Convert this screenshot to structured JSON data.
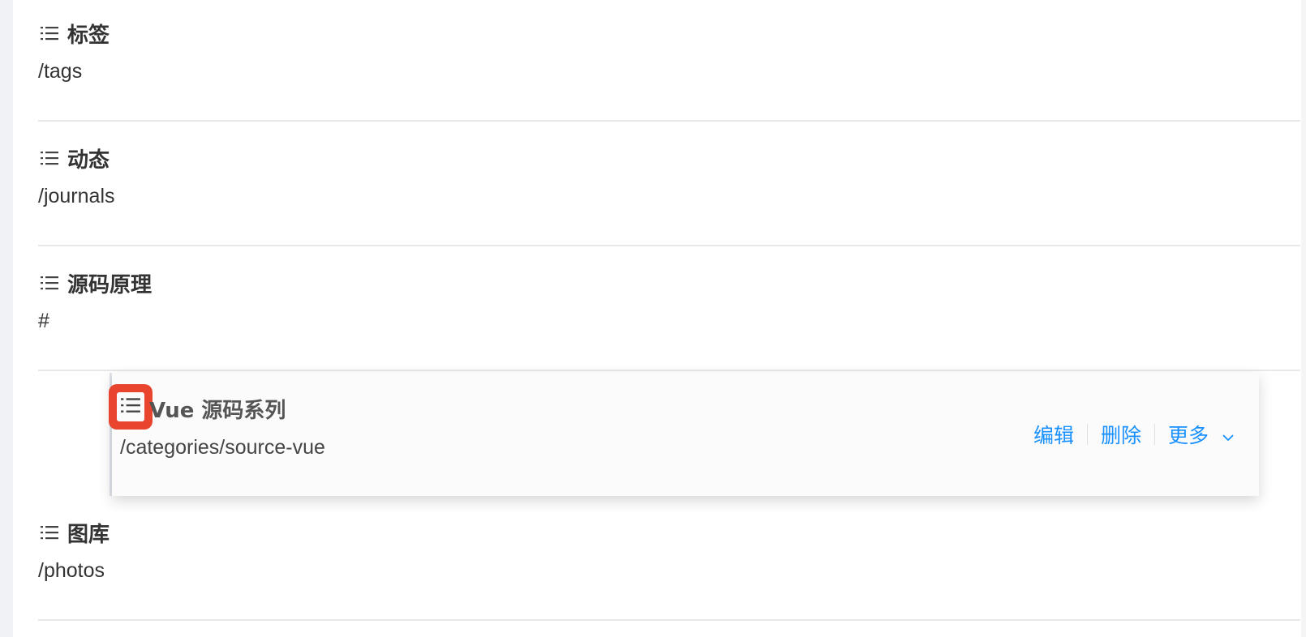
{
  "menu_items": [
    {
      "title": "标签",
      "url": "/tags"
    },
    {
      "title": "动态",
      "url": "/journals"
    },
    {
      "title": "源码原理",
      "url": "#"
    },
    {
      "title": "图库",
      "url": "/photos"
    }
  ],
  "dragging_item": {
    "title": "Vue 源码系列",
    "url": "/categories/source-vue",
    "actions": {
      "edit": "编辑",
      "delete": "删除",
      "more": "更多"
    }
  },
  "colors": {
    "accent": "#1890ff",
    "highlight": "#e9442e"
  },
  "icons": {
    "drag_handle": "list-icon",
    "more_dropdown": "chevron-down-icon"
  }
}
